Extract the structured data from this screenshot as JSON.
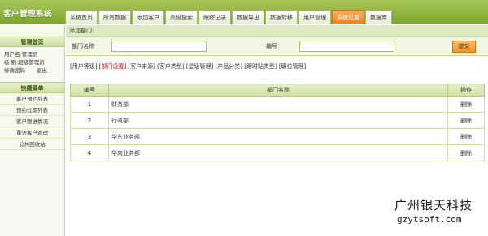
{
  "app": {
    "title": "客户管理系统"
  },
  "tabs": [
    {
      "label": "系统首页"
    },
    {
      "label": "所有数据"
    },
    {
      "label": "添加客户"
    },
    {
      "label": "高级搜索"
    },
    {
      "label": "跟踪记录"
    },
    {
      "label": "数据导出"
    },
    {
      "label": "数据转移"
    },
    {
      "label": "用户管理"
    },
    {
      "label": "系统设置",
      "active": true
    },
    {
      "label": "数据库"
    }
  ],
  "sidebar": {
    "home_title": "管理首页",
    "user_line": "用户名:管理员",
    "role_line": "级  别:超级管理员",
    "change_password": "修改密码",
    "logout": "退出",
    "quick_title": "快捷菜单",
    "menu": [
      {
        "label": "客户预约列表"
      },
      {
        "label": "预约过期列表"
      },
      {
        "label": "客户跟进情况"
      },
      {
        "label": "重访客户管理"
      },
      {
        "label": "公共回收站"
      }
    ]
  },
  "main": {
    "crumb": "添加部门:",
    "form": {
      "dept_label": "部门名称",
      "dept_value": "",
      "code_label": "编号",
      "code_value": "",
      "submit_label": "提交"
    },
    "links": [
      {
        "label": "用户等级",
        "active": false
      },
      {
        "label": "部门设置",
        "active": true
      },
      {
        "label": "客户来源",
        "active": false
      },
      {
        "label": "客户类型",
        "active": false
      },
      {
        "label": "星级管理",
        "active": false
      },
      {
        "label": "产品分类",
        "active": false
      },
      {
        "label": "跟时贴类型",
        "active": false
      },
      {
        "label": "职位管理",
        "active": false
      }
    ],
    "table": {
      "headers": {
        "no": "编号",
        "name": "部门名称",
        "op": "操作"
      },
      "rows": [
        {
          "no": "1",
          "name": "财务部",
          "op": "删除"
        },
        {
          "no": "2",
          "name": "行政部",
          "op": "删除"
        },
        {
          "no": "3",
          "name": "华东业务部",
          "op": "删除"
        },
        {
          "no": "4",
          "name": "华南业务部",
          "op": "删除"
        }
      ]
    }
  },
  "watermark": {
    "line1": "广州银天科技",
    "line2": "gzytsoft.com"
  },
  "colors": {
    "accent": "#ee7d14",
    "brand_green": "#7da52c",
    "active_link": "#d10000"
  }
}
